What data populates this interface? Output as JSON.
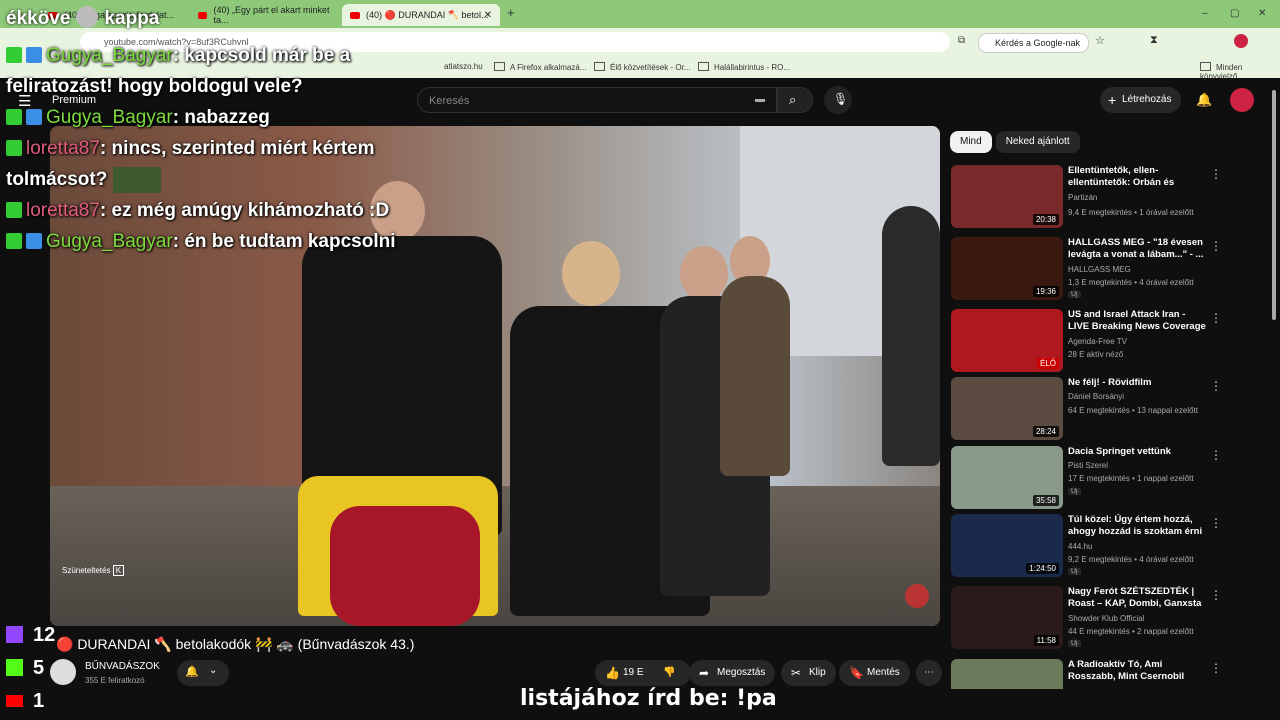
{
  "browser": {
    "tabs": [
      {
        "label": "(40) Megalapozta fordulat..."
      },
      {
        "label": "(40) „Egy párt el akart minket ta..."
      },
      {
        "label": "(40) 🔴 DURANDAI 🪓 betol..."
      }
    ],
    "new_tab": "+",
    "url": "youtube.com/watch?v=8uf3RCuhvnI",
    "google_button": "Kérdés a Google-nak",
    "bookmarks": [
      "atlatszo.hu",
      "A Firefox alkalmazá...",
      "Élő közvetítések - Or...",
      "Halállabirintus - RO...",
      "Minden könyvjelző"
    ]
  },
  "youtube": {
    "search_placeholder": "Keresés",
    "create_label": "Létrehozás",
    "premium": "Premium"
  },
  "stream_overlay": {
    "top_text_1": "ékköve",
    "top_text_2": "kappa",
    "messages": [
      {
        "user": "Gugya_Bagyar",
        "text": ": kapcsold már be a feliratozást! hogy boldogul vele?",
        "color": "#7cdc3c",
        "badges": [
          "k",
          "a"
        ]
      },
      {
        "user": "Gugya_Bagyar",
        "text": ": nabazzeg",
        "color": "#7cdc3c",
        "badges": [
          "k",
          "a"
        ]
      },
      {
        "user": "loretta87",
        "text": ": nincs, szerinted miért kértem tolmácsot?",
        "color": "#e05c7c",
        "badges": [
          "k"
        ]
      },
      {
        "user": "loretta87",
        "text": ": ez még amúgy kihámozható :D",
        "color": "#e05c7c",
        "badges": [
          "k"
        ]
      },
      {
        "user": "Gugya_Bagyar",
        "text": ": én be tudtam kapcsolni",
        "color": "#7cdc3c",
        "badges": [
          "k",
          "a"
        ]
      }
    ],
    "counters": [
      {
        "platform": "twitch",
        "count": "12",
        "color": "#9146ff"
      },
      {
        "platform": "kick",
        "count": "5",
        "color": "#53fc18"
      },
      {
        "platform": "youtube",
        "count": "1",
        "color": "#ff0000"
      }
    ],
    "caption": "listájához írd be: !pa"
  },
  "video": {
    "title": "🔴 DURANDAI 🪓 betolakodók 🚧 🚓 (Bűnvadászok 43.)",
    "pause_hint": "Szüneteltetés",
    "pause_key": "K",
    "channel": "BŰNVADÁSZOK",
    "subscribers": "355 E feliratkozó",
    "likes": "19 E",
    "share": "Megosztás",
    "clip": "Klip",
    "save": "Mentés"
  },
  "sidebar": {
    "chips": [
      "Mind",
      "Neked ajánlott"
    ],
    "items": [
      {
        "title": "Ellentüntetők, ellen-ellentüntetők: Orbán és Magy...",
        "channel": "Partizán",
        "meta": "9,4 E megtekintés • 1 órával ezelőtt",
        "duration": "20:38",
        "badge": "",
        "thumb": "#7a2a2a"
      },
      {
        "title": "HALLGASS MEG - \"18 évesen levágta a vonat a lábam...\" - ...",
        "channel": "HALLGASS MEG",
        "meta": "1,3 E megtekintés • 4 órával ezelőtt",
        "duration": "19:36",
        "badge": "Új",
        "thumb": "#3a1a10"
      },
      {
        "title": "US and Israel Attack Iran - LIVE Breaking News Coverage & W...",
        "channel": "Agenda-Free TV",
        "meta": "28 E aktív néző",
        "duration": "ÉLŐ",
        "badge": "",
        "thumb": "#b01820"
      },
      {
        "title": "Ne félj! - Rövidfilm",
        "channel": "Dániel Borsányi",
        "meta": "64 E megtekintés • 13 nappal ezelőtt",
        "duration": "28:24",
        "badge": "",
        "thumb": "#5a4a40"
      },
      {
        "title": "Dacia Springet vettünk",
        "channel": "Pisti Szerel",
        "meta": "17 E megtekintés • 1 nappal ezelőtt",
        "duration": "35:58",
        "badge": "Új",
        "thumb": "#8a9a8a"
      },
      {
        "title": "Túl közel: Úgy értem hozzá, ahogy hozzád is szoktam érni",
        "channel": "444.hu",
        "meta": "9,2 E megtekintés • 4 órával ezelőtt",
        "duration": "1:24:50",
        "badge": "Új",
        "thumb": "#1a2a4a"
      },
      {
        "title": "Nagy Ferót SZÉTSZEDTÉK | Roast – KAP, Dombi, Ganxsta",
        "channel": "Showder Klub Official",
        "meta": "44 E megtekintés • 2 nappal ezelőtt",
        "duration": "11:58",
        "badge": "Új",
        "thumb": "#2a1a1a"
      },
      {
        "title": "A Radioaktív Tó, Ami Rosszabb, Mint Csernobil",
        "channel": "",
        "meta": "",
        "duration": "",
        "badge": "",
        "thumb": "#6a7a5a"
      }
    ]
  }
}
